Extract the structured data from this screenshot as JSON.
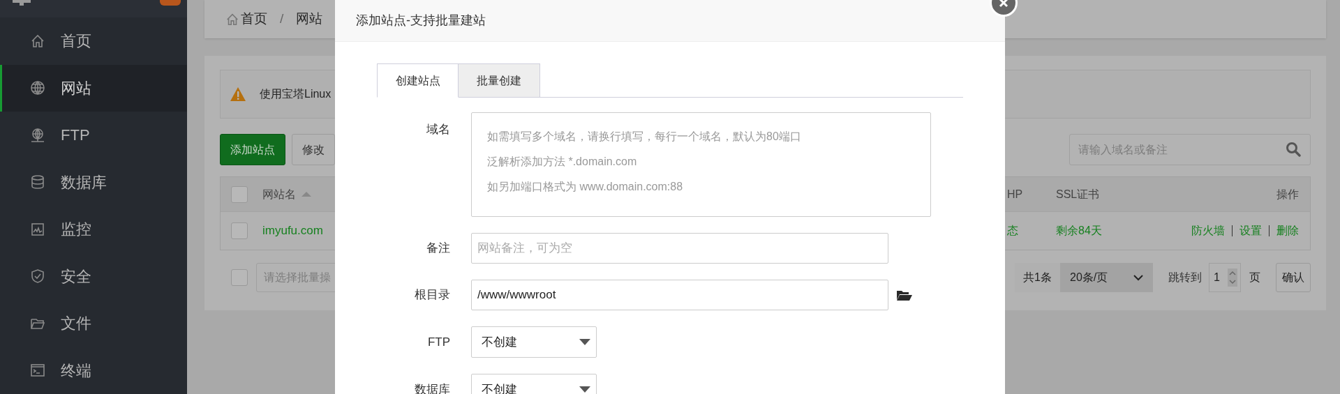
{
  "sidebar": {
    "items": [
      {
        "label": "首页",
        "selected": false
      },
      {
        "label": "网站",
        "selected": true
      },
      {
        "label": "FTP",
        "selected": false
      },
      {
        "label": "数据库",
        "selected": false
      },
      {
        "label": "监控",
        "selected": false
      },
      {
        "label": "安全",
        "selected": false
      },
      {
        "label": "文件",
        "selected": false
      },
      {
        "label": "终端",
        "selected": false
      }
    ]
  },
  "breadcrumb": {
    "items": [
      "首页",
      "网站"
    ],
    "separator": "/"
  },
  "alert": {
    "text": "使用宝塔Linux"
  },
  "toolbar": {
    "buttons": [
      {
        "label": "添加站点",
        "kind": "primary"
      },
      {
        "label": "修改",
        "kind": "default"
      }
    ],
    "search": {
      "placeholder": "请输入域名或备注"
    }
  },
  "table": {
    "columns": [
      "网站名",
      "HP",
      "SSL证书",
      "操作"
    ],
    "header_checked": false,
    "rows": [
      {
        "checked": false,
        "name": "imyufu.com",
        "php": "态",
        "ssl": "剩余84天",
        "actions": [
          "防火墙",
          "设置",
          "删除"
        ]
      }
    ]
  },
  "footer": {
    "checked": false,
    "batch_placeholder": "请选择批量操",
    "total": "共1条",
    "page_size": "20条/页",
    "jump_label": "跳转到",
    "page_value": "1",
    "page_unit": "页",
    "confirm": "确认"
  },
  "modal": {
    "title": "添加站点-支持批量建站",
    "tabs": [
      {
        "label": "创建站点",
        "selected": true
      },
      {
        "label": "批量创建",
        "selected": false
      }
    ],
    "fields": [
      {
        "kind": "textarea",
        "label": "域名",
        "placeholder_lines": [
          "如需填写多个域名，请换行填写，每行一个域名，默认为80端口",
          "泛解析添加方法 *.domain.com",
          "如另加端口格式为 www.domain.com:88"
        ]
      },
      {
        "kind": "input",
        "label": "备注",
        "placeholder": "网站备注，可为空"
      },
      {
        "kind": "path",
        "label": "根目录",
        "value": "/www/wwwroot"
      },
      {
        "kind": "select",
        "label": "FTP",
        "value": "不创建"
      },
      {
        "kind": "select",
        "label": "数据库",
        "value": "不创建"
      }
    ]
  }
}
